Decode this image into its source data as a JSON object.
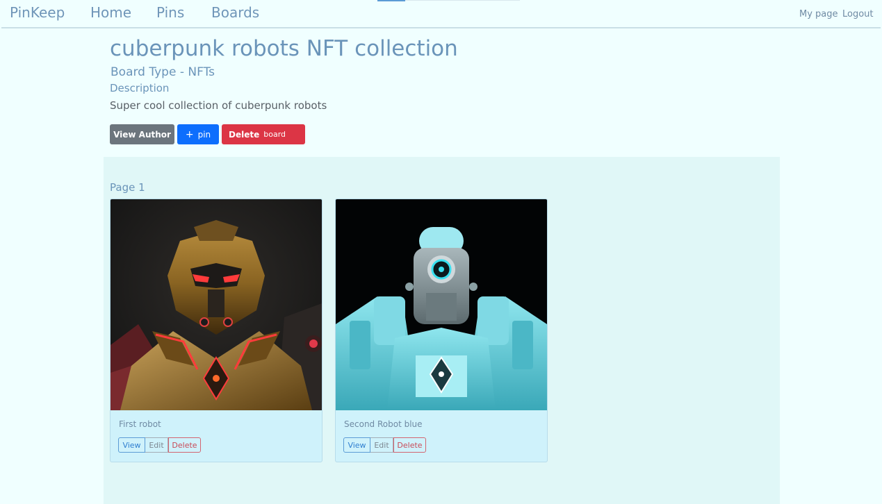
{
  "nav": {
    "brand": "PinKeep",
    "links": [
      "Home",
      "Pins",
      "Boards"
    ],
    "right_links": [
      "My page",
      "Logout"
    ]
  },
  "board": {
    "title": "cuberpunk robots NFT collection",
    "type_line": "Board Type - NFTs",
    "description_label": "Description",
    "description": "Super cool collection of cuberpunk robots"
  },
  "actions": {
    "view_author": "View Author",
    "pin_plus": "+",
    "pin": "pin",
    "delete_strong": "Delete",
    "delete_small": "board"
  },
  "page_label": "Page 1",
  "pins": [
    {
      "title": "First robot",
      "view": "View",
      "edit": "Edit",
      "delete": "Delete",
      "image": "gold-robot-image"
    },
    {
      "title": "Second Robot blue",
      "view": "View",
      "edit": "Edit",
      "delete": "Delete",
      "image": "cyan-robot-image"
    }
  ],
  "colors": {
    "page_bg": "#f0ffff",
    "panel_bg": "#e0f7f7",
    "card_bg": "#cff2fb",
    "link": "#6f95b8",
    "secondary_btn": "#6c757d",
    "primary_btn": "#0d6efd",
    "danger_btn": "#dc3545"
  }
}
